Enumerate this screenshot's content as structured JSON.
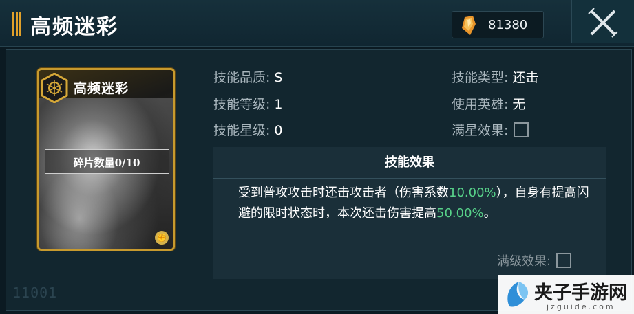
{
  "header": {
    "title": "高频迷彩",
    "currency_icon": "crystal-icon",
    "currency_amount": "81380",
    "close_icon": "close-icon"
  },
  "card": {
    "title": "高频迷彩",
    "fragment_label": "碎片数量0/10",
    "emblem_icon": "hexagon-emblem-icon",
    "type_badge_icon": "fist-icon"
  },
  "info": {
    "quality_label": "技能品质:",
    "quality_value": "S",
    "level_label": "技能等级:",
    "level_value": "1",
    "star_label": "技能星级:",
    "star_value": "0",
    "type_label": "技能类型:",
    "type_value": "还击",
    "hero_label": "使用英雄:",
    "hero_value": "无",
    "max_star_label": "满星效果:"
  },
  "effect": {
    "title": "技能效果",
    "desc_part1": "受到普攻攻击时还击攻击者（伤害系数",
    "desc_hl1": "10.00%",
    "desc_part2": "），自身有提高闪避的限时状态时，本次还击伤害提高",
    "desc_hl2": "50.00%",
    "desc_part3": "。",
    "max_level_label": "满级效果:"
  },
  "footer": {
    "id": "11001"
  },
  "watermark": {
    "name": "夹子手游网",
    "url": "jzguide.com"
  },
  "colors": {
    "accent_gold": "#c79a2e",
    "highlight_green": "#57d189"
  }
}
